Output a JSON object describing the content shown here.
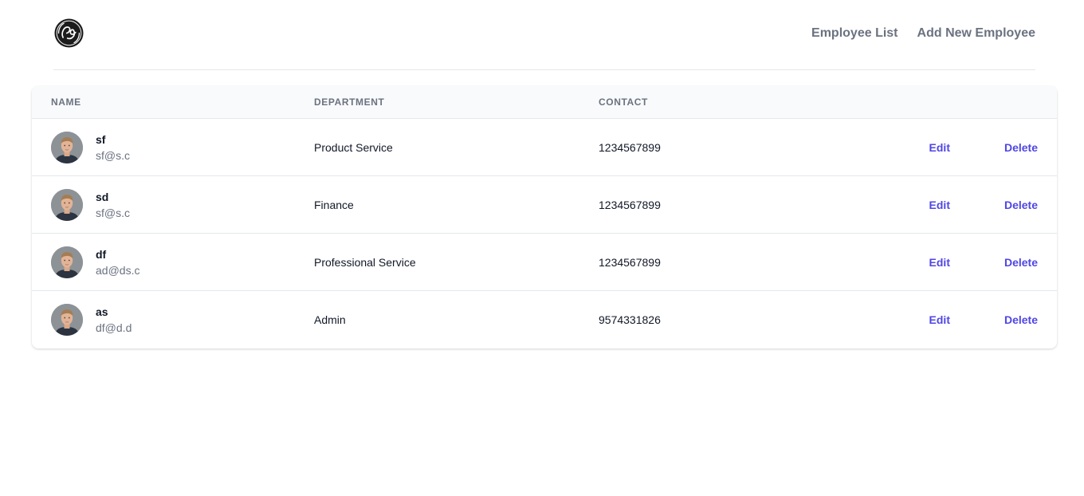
{
  "header": {
    "nav": [
      "Employee List",
      "Add New Employee"
    ]
  },
  "table": {
    "columns": [
      "Name",
      "Department",
      "Contact"
    ],
    "edit_label": "Edit",
    "delete_label": "Delete",
    "rows": [
      {
        "name": "sf",
        "email": "sf@s.c",
        "department": "Product Service",
        "contact": "1234567899"
      },
      {
        "name": "sd",
        "email": "sf@s.c",
        "department": "Finance",
        "contact": "1234567899"
      },
      {
        "name": "df",
        "email": "ad@ds.c",
        "department": "Professional Service",
        "contact": "1234567899"
      },
      {
        "name": "as",
        "email": "df@d.d",
        "department": "Admin",
        "contact": "9574331826"
      }
    ]
  },
  "colors": {
    "accent": "#4f46e5",
    "muted_text": "#6b7280",
    "header_bg": "#f9fafb",
    "border": "#e5e7eb"
  },
  "icons": {
    "logo": "ge-logo",
    "avatar": "user-avatar-photo"
  }
}
